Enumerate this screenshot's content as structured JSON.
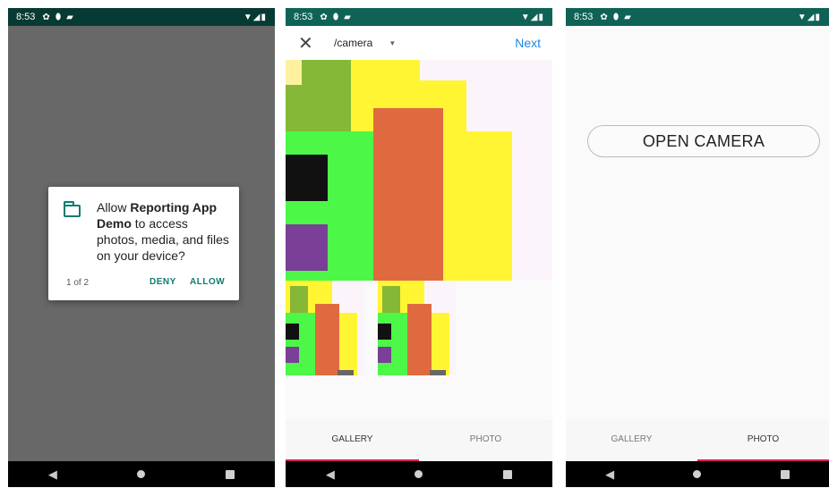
{
  "status_bar": {
    "time": "8:53"
  },
  "permission_dialog": {
    "text_before": "Allow ",
    "app_name": "Reporting App Demo",
    "text_after": " to access photos, media, and files on your device?",
    "counter": "1 of 2",
    "deny_label": "DENY",
    "allow_label": "ALLOW"
  },
  "gallery_screen": {
    "folder": "/camera",
    "next_label": "Next",
    "tabs": [
      {
        "label": "GALLERY",
        "active": true
      },
      {
        "label": "PHOTO",
        "active": false
      }
    ]
  },
  "camera_screen": {
    "open_camera_label": "OPEN CAMERA",
    "tabs": [
      {
        "label": "GALLERY",
        "active": false
      },
      {
        "label": "PHOTO",
        "active": true
      }
    ]
  },
  "colors": {
    "status_bar": "#0f6356",
    "accent_teal": "#0d7c6e",
    "link_blue": "#1e88e5",
    "tab_indicator": "#d81b60",
    "image_yellow": "#fff533",
    "image_green": "#4cf748",
    "image_olive": "#84b836",
    "image_orange": "#e06a3f",
    "image_purple": "#7a3f97",
    "image_black": "#111111"
  },
  "icons": [
    "gear-icon",
    "shield-icon",
    "sd-card-icon",
    "wifi-icon",
    "signal-icon",
    "battery-icon",
    "folder-icon",
    "close-icon",
    "dropdown-caret-icon",
    "back-icon",
    "home-icon",
    "recents-icon"
  ]
}
